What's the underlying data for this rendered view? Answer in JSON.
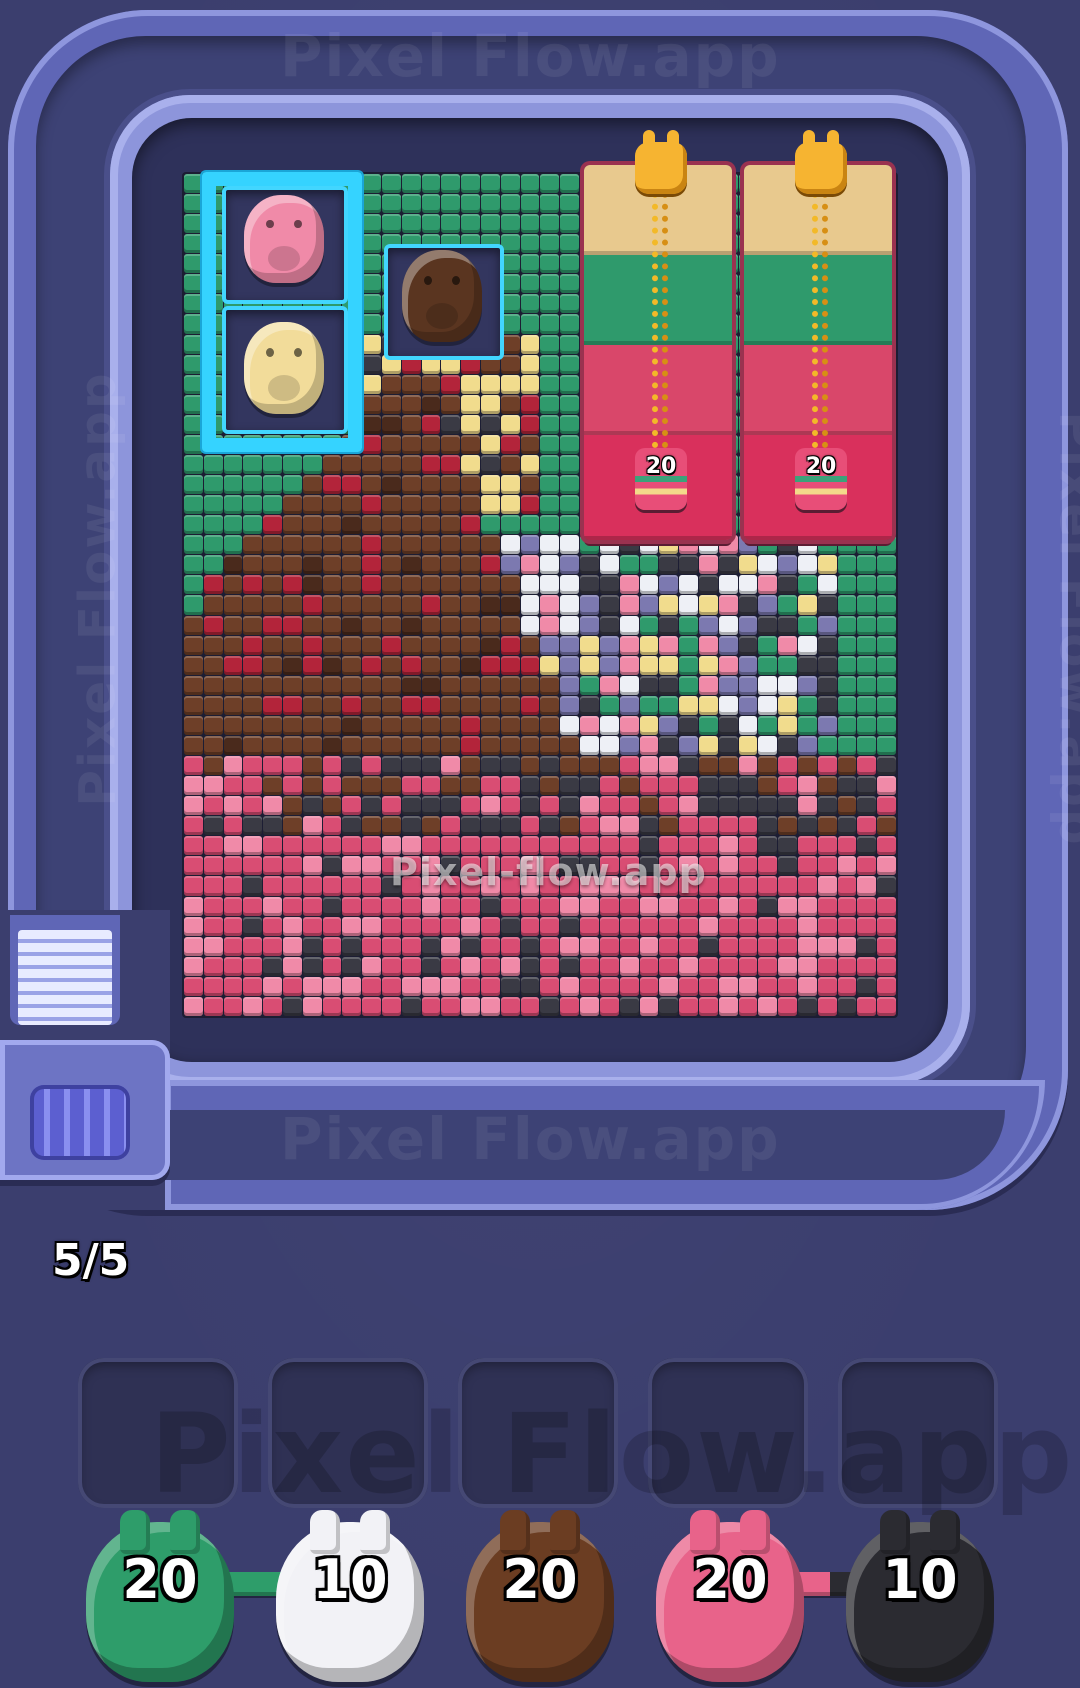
{
  "watermark": {
    "top": "Pixel Flow.app",
    "center": "Pixel-flow.app",
    "track_bottom": "Pixel Flow.app",
    "tray": "Pixel Flow.app",
    "side_left": "Pixel Flow.app",
    "side_right": "Pixel Flow.app"
  },
  "conveyor": {
    "capacity_label": "5/5"
  },
  "board": {
    "animals": [
      {
        "name": "pink-pig",
        "color": "#f08aa8"
      },
      {
        "name": "cream-pig",
        "color": "#f2dc9a"
      },
      {
        "name": "brown-pig",
        "color": "#5a3520"
      }
    ],
    "locked_crates": [
      {
        "count": "20",
        "bands": [
          "#e8c98e",
          "#2f9a6c",
          "#d9476a",
          "#d9305c"
        ]
      },
      {
        "count": "20",
        "bands": [
          "#e8c98e",
          "#2f9a6c",
          "#d9476a",
          "#d9305c"
        ]
      }
    ]
  },
  "tray": {
    "slots": 5
  },
  "queue": [
    {
      "count": "20",
      "color": "#2e9d6a",
      "name": "green-shooter"
    },
    {
      "count": "10",
      "color": "#f2f2f6",
      "name": "white-shooter"
    },
    {
      "count": "20",
      "color": "#6b3d22",
      "name": "brown-shooter"
    },
    {
      "count": "20",
      "color": "#e8638a",
      "name": "pink-shooter"
    },
    {
      "count": "10",
      "color": "#2b2b31",
      "name": "black-shooter"
    }
  ]
}
